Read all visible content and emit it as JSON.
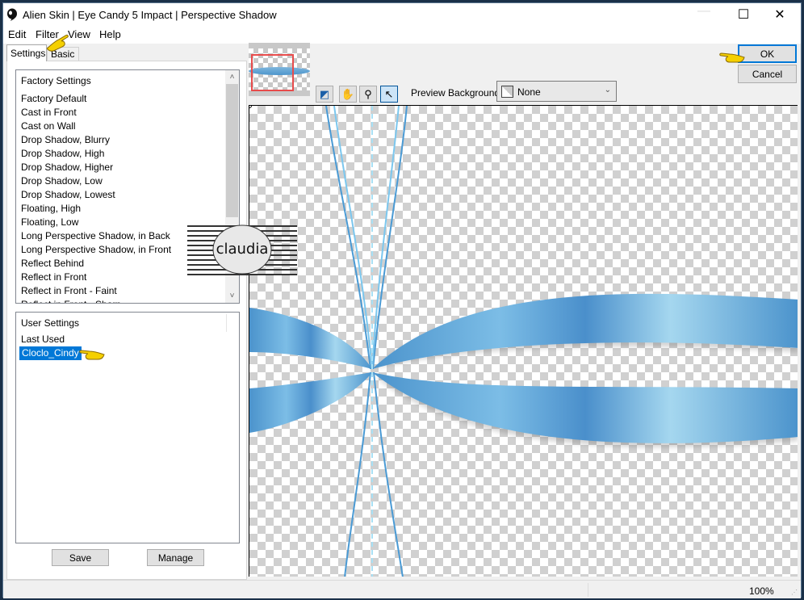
{
  "window": {
    "title": "Alien Skin | Eye Candy 5 Impact | Perspective Shadow",
    "controls": {
      "minimize": "—",
      "maximize": "☐",
      "close": "✕"
    }
  },
  "menu": [
    "Edit",
    "Filter",
    "View",
    "Help"
  ],
  "tabs": [
    {
      "label": "Settings",
      "active": true
    },
    {
      "label": "Basic",
      "active": false
    }
  ],
  "factory_settings": {
    "header": "Factory Settings",
    "items": [
      "Factory Default",
      "Cast in Front",
      "Cast on Wall",
      "Drop Shadow, Blurry",
      "Drop Shadow, High",
      "Drop Shadow, Higher",
      "Drop Shadow, Low",
      "Drop Shadow, Lowest",
      "Floating, High",
      "Floating, Low",
      "Long Perspective Shadow, in Back",
      "Long Perspective Shadow, in Front",
      "Reflect Behind",
      "Reflect in Front",
      "Reflect in Front - Faint",
      "Reflect in Front - Sharp"
    ],
    "scroll_up": "˄",
    "scroll_down": "˅"
  },
  "user_settings": {
    "header": "User Settings",
    "items": [
      "Last Used",
      "Cloclo_Cindy"
    ],
    "selected": "Cloclo_Cindy"
  },
  "buttons": {
    "save": "Save",
    "manage": "Manage",
    "ok": "OK",
    "cancel": "Cancel"
  },
  "toolbar": {
    "tools": [
      {
        "name": "preview-toggle-icon",
        "glyph": "◩"
      },
      {
        "name": "hand-icon",
        "glyph": "✋"
      },
      {
        "name": "zoom-icon",
        "glyph": "⚲"
      },
      {
        "name": "pointer-icon",
        "glyph": "↖"
      }
    ],
    "active_tool": "pointer-icon"
  },
  "preview_background": {
    "label": "Preview Background:",
    "value": "None",
    "arrow": "⌄"
  },
  "status": {
    "zoom": "100%"
  },
  "watermark": {
    "text": "claudia"
  },
  "colors": {
    "ribbon": "#5aa2d8",
    "ribbon_light": "#a8d8f0",
    "selection": "#0078d7",
    "nav_frame": "#e84c4c",
    "pointer_hand": "#f5d000"
  }
}
